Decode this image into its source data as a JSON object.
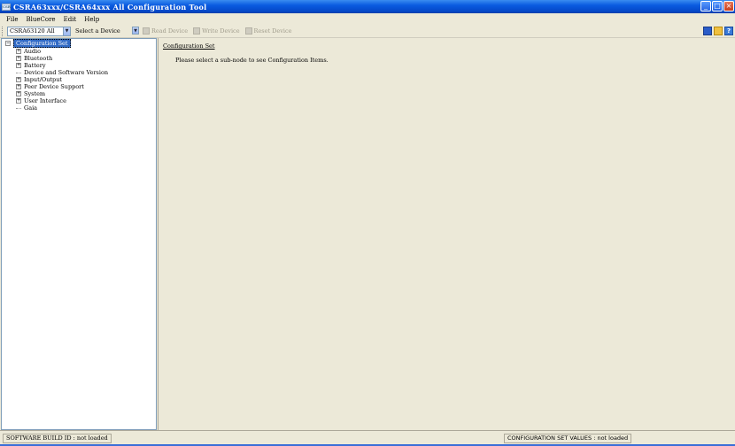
{
  "window": {
    "title": "CSRA63xxx/CSRA64xxx All Configuration Tool",
    "app_icon_text": "CSR"
  },
  "menu": {
    "items": [
      "File",
      "BlueCore",
      "Edit",
      "Help"
    ]
  },
  "toolbar": {
    "device_type_value": "CSRA63120 All",
    "device_select_value": "Select a Device",
    "read_device_label": "Read Device",
    "write_device_label": "Write Device",
    "reset_device_label": "Reset Device"
  },
  "tree": {
    "root_label": "Configuration Set",
    "items": [
      {
        "label": "Audio",
        "expandable": true
      },
      {
        "label": "Bluetooth",
        "expandable": true
      },
      {
        "label": "Battery",
        "expandable": true
      },
      {
        "label": "Device and Software Version",
        "expandable": false
      },
      {
        "label": "Input/Output",
        "expandable": true
      },
      {
        "label": "Peer Device Support",
        "expandable": true
      },
      {
        "label": "System",
        "expandable": true
      },
      {
        "label": "User Interface",
        "expandable": true
      },
      {
        "label": "Gaia",
        "expandable": false
      }
    ]
  },
  "content": {
    "title": "Configuration Set",
    "message": "Please select a sub-node to see Configuration Items."
  },
  "status": {
    "software_build": "SOFTWARE BUILD ID : not loaded",
    "config_set_values": "CONFIGURATION SET VALUES : not loaded"
  }
}
